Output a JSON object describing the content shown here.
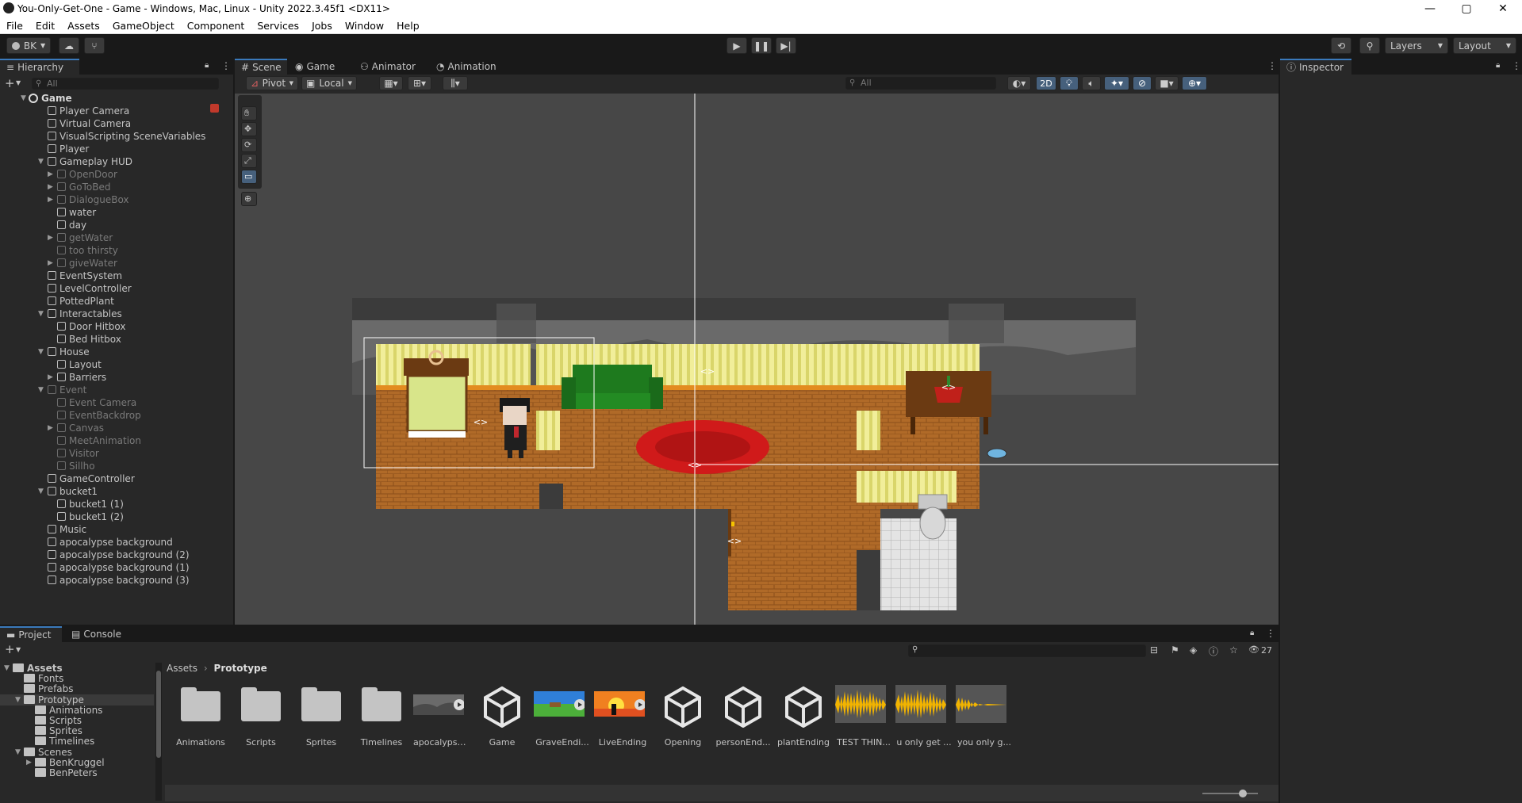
{
  "window": {
    "title": "You-Only-Get-One - Game - Windows, Mac, Linux - Unity 2022.3.45f1 <DX11>",
    "minimize": "—",
    "maximize": "▢",
    "close": "✕"
  },
  "menu": [
    "File",
    "Edit",
    "Assets",
    "GameObject",
    "Component",
    "Services",
    "Jobs",
    "Window",
    "Help"
  ],
  "toolbar": {
    "account": "BK",
    "layers": "Layers",
    "layout": "Layout"
  },
  "hierarchy": {
    "tab": "Hierarchy",
    "search_placeholder": "All",
    "scene": "Game",
    "items": [
      {
        "label": "Player Camera",
        "depth": 1,
        "dim": false,
        "expand": ""
      },
      {
        "label": "Virtual Camera",
        "depth": 1,
        "dim": false,
        "expand": ""
      },
      {
        "label": "VisualScripting SceneVariables",
        "depth": 1,
        "dim": false,
        "expand": ""
      },
      {
        "label": "Player",
        "depth": 1,
        "dim": false,
        "expand": ""
      },
      {
        "label": "Gameplay HUD",
        "depth": 1,
        "dim": false,
        "expand": "▼"
      },
      {
        "label": "OpenDoor",
        "depth": 2,
        "dim": true,
        "expand": "▶"
      },
      {
        "label": "GoToBed",
        "depth": 2,
        "dim": true,
        "expand": "▶"
      },
      {
        "label": "DialogueBox",
        "depth": 2,
        "dim": true,
        "expand": "▶"
      },
      {
        "label": "water",
        "depth": 2,
        "dim": false,
        "expand": ""
      },
      {
        "label": "day",
        "depth": 2,
        "dim": false,
        "expand": ""
      },
      {
        "label": "getWater",
        "depth": 2,
        "dim": true,
        "expand": "▶"
      },
      {
        "label": "too thirsty",
        "depth": 2,
        "dim": true,
        "expand": ""
      },
      {
        "label": "giveWater",
        "depth": 2,
        "dim": true,
        "expand": "▶"
      },
      {
        "label": "EventSystem",
        "depth": 1,
        "dim": false,
        "expand": ""
      },
      {
        "label": "LevelController",
        "depth": 1,
        "dim": false,
        "expand": ""
      },
      {
        "label": "PottedPlant",
        "depth": 1,
        "dim": false,
        "expand": ""
      },
      {
        "label": "Interactables",
        "depth": 1,
        "dim": false,
        "expand": "▼"
      },
      {
        "label": "Door Hitbox",
        "depth": 2,
        "dim": false,
        "expand": ""
      },
      {
        "label": "Bed Hitbox",
        "depth": 2,
        "dim": false,
        "expand": ""
      },
      {
        "label": "House",
        "depth": 1,
        "dim": false,
        "expand": "▼"
      },
      {
        "label": "Layout",
        "depth": 2,
        "dim": false,
        "expand": ""
      },
      {
        "label": "Barriers",
        "depth": 2,
        "dim": false,
        "expand": "▶"
      },
      {
        "label": "Event",
        "depth": 1,
        "dim": true,
        "expand": "▼"
      },
      {
        "label": "Event Camera",
        "depth": 2,
        "dim": true,
        "expand": ""
      },
      {
        "label": "EventBackdrop",
        "depth": 2,
        "dim": true,
        "expand": ""
      },
      {
        "label": "Canvas",
        "depth": 2,
        "dim": true,
        "expand": "▶"
      },
      {
        "label": "MeetAnimation",
        "depth": 2,
        "dim": true,
        "expand": ""
      },
      {
        "label": "Visitor",
        "depth": 2,
        "dim": true,
        "expand": ""
      },
      {
        "label": "Sillho",
        "depth": 2,
        "dim": true,
        "expand": ""
      },
      {
        "label": "GameController",
        "depth": 1,
        "dim": false,
        "expand": ""
      },
      {
        "label": "bucket1",
        "depth": 1,
        "dim": false,
        "expand": "▼"
      },
      {
        "label": "bucket1 (1)",
        "depth": 2,
        "dim": false,
        "expand": ""
      },
      {
        "label": "bucket1 (2)",
        "depth": 2,
        "dim": false,
        "expand": ""
      },
      {
        "label": "Music",
        "depth": 1,
        "dim": false,
        "expand": ""
      },
      {
        "label": "apocalypse background",
        "depth": 1,
        "dim": false,
        "expand": ""
      },
      {
        "label": "apocalypse background (2)",
        "depth": 1,
        "dim": false,
        "expand": ""
      },
      {
        "label": "apocalypse background (1)",
        "depth": 1,
        "dim": false,
        "expand": ""
      },
      {
        "label": "apocalypse background (3)",
        "depth": 1,
        "dim": false,
        "expand": ""
      }
    ]
  },
  "scene_tabs": {
    "scene": "Scene",
    "game": "Game",
    "animator": "Animator",
    "animation": "Animation"
  },
  "scene_toolbar": {
    "pivot": "Pivot",
    "local": "Local",
    "search_placeholder": "All",
    "mode_2d": "2D"
  },
  "inspector": {
    "tab": "Inspector"
  },
  "project": {
    "tab": "Project",
    "console_tab": "Console",
    "count": "27",
    "breadcrumb_root": "Assets",
    "breadcrumb_current": "Prototype",
    "tree": [
      {
        "label": "Assets",
        "depth": 0,
        "expand": "▼",
        "bold": true
      },
      {
        "label": "Fonts",
        "depth": 1,
        "expand": ""
      },
      {
        "label": "Prefabs",
        "depth": 1,
        "expand": ""
      },
      {
        "label": "Prototype",
        "depth": 1,
        "expand": "▼",
        "selected": true
      },
      {
        "label": "Animations",
        "depth": 2,
        "expand": ""
      },
      {
        "label": "Scripts",
        "depth": 2,
        "expand": ""
      },
      {
        "label": "Sprites",
        "depth": 2,
        "expand": ""
      },
      {
        "label": "Timelines",
        "depth": 2,
        "expand": ""
      },
      {
        "label": "Scenes",
        "depth": 1,
        "expand": "▼"
      },
      {
        "label": "BenKruggel",
        "depth": 2,
        "expand": "▶"
      },
      {
        "label": "BenPeters",
        "depth": 2,
        "expand": ""
      }
    ],
    "assets": [
      {
        "label": "Animations",
        "kind": "folder"
      },
      {
        "label": "Scripts",
        "kind": "folder"
      },
      {
        "label": "Sprites",
        "kind": "folder"
      },
      {
        "label": "Timelines",
        "kind": "folder"
      },
      {
        "label": "apocalypse...",
        "kind": "thumb-apoc"
      },
      {
        "label": "Game",
        "kind": "unity"
      },
      {
        "label": "GraveEndi...",
        "kind": "thumb-grave"
      },
      {
        "label": "LiveEnding",
        "kind": "thumb-live"
      },
      {
        "label": "Opening",
        "kind": "unity"
      },
      {
        "label": "personEnd...",
        "kind": "unity"
      },
      {
        "label": "plantEnding",
        "kind": "unity"
      },
      {
        "label": "TEST THIN...",
        "kind": "audio"
      },
      {
        "label": "u only get ...",
        "kind": "audio"
      },
      {
        "label": "you only g...",
        "kind": "audio-thin"
      }
    ]
  },
  "colors": {
    "accent": "#3a79bb",
    "panel": "#282828",
    "scene_bg": "#474747"
  }
}
